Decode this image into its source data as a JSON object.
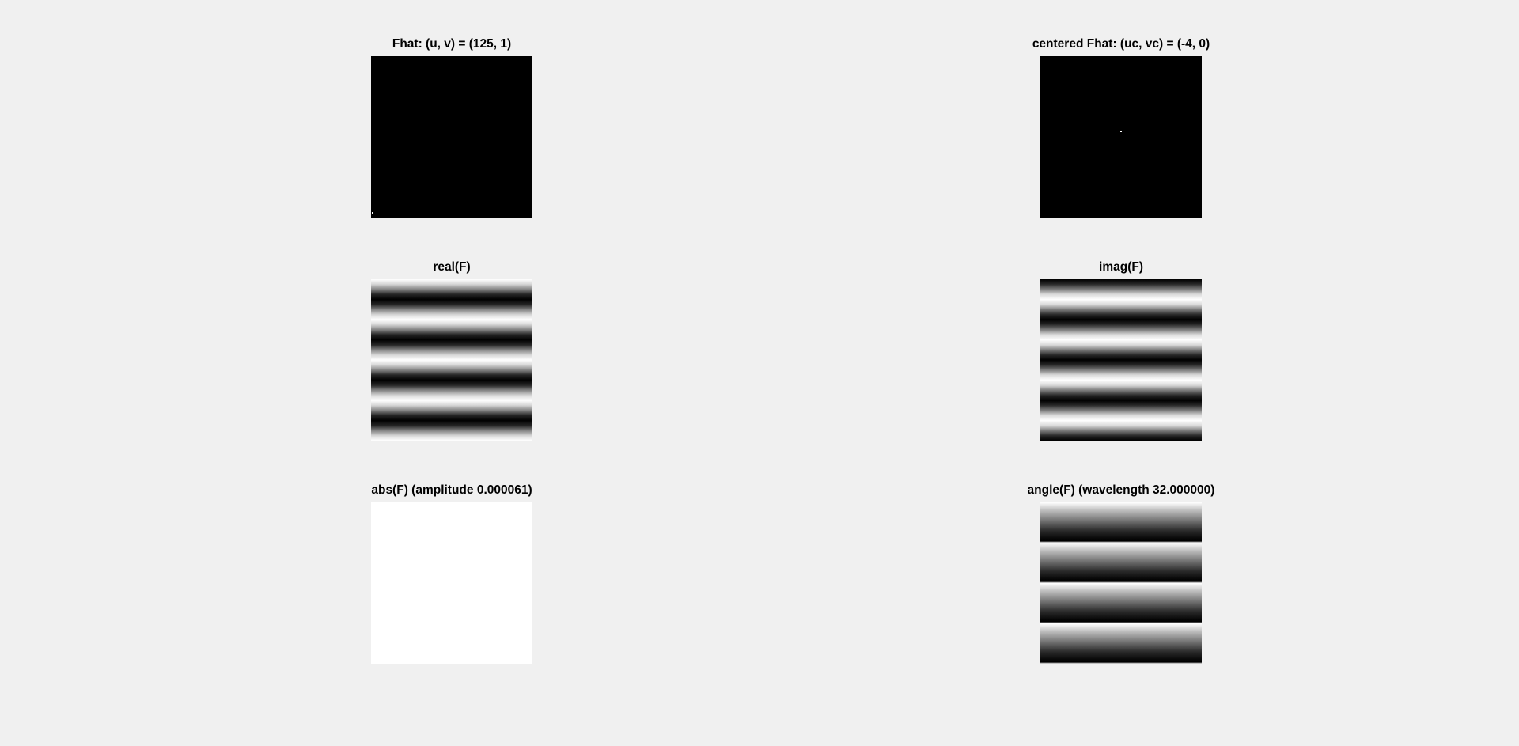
{
  "figure": {
    "background_color": "#f0f0f0",
    "subplots": {
      "fhat": {
        "title": "Fhat: (u, v) = (125, 1)",
        "colormap": "gray",
        "content": "black image with single bright pixel at lower-left corner"
      },
      "centered": {
        "title": "centered Fhat: (uc, vc) = (-4, 0)",
        "colormap": "gray",
        "content": "black image with single bright pixel near center"
      },
      "real": {
        "title": "real(F)",
        "colormap": "gray",
        "content": "horizontal cosine stripes"
      },
      "imag": {
        "title": "imag(F)",
        "colormap": "gray",
        "content": "horizontal sine stripes"
      },
      "abs": {
        "title": "abs(F) (amplitude 0.000061)",
        "colormap": "gray",
        "content": "uniform white"
      },
      "angle": {
        "title": "angle(F) (wavelength 32.000000)",
        "colormap": "gray",
        "content": "horizontal sawtooth bands"
      }
    }
  }
}
